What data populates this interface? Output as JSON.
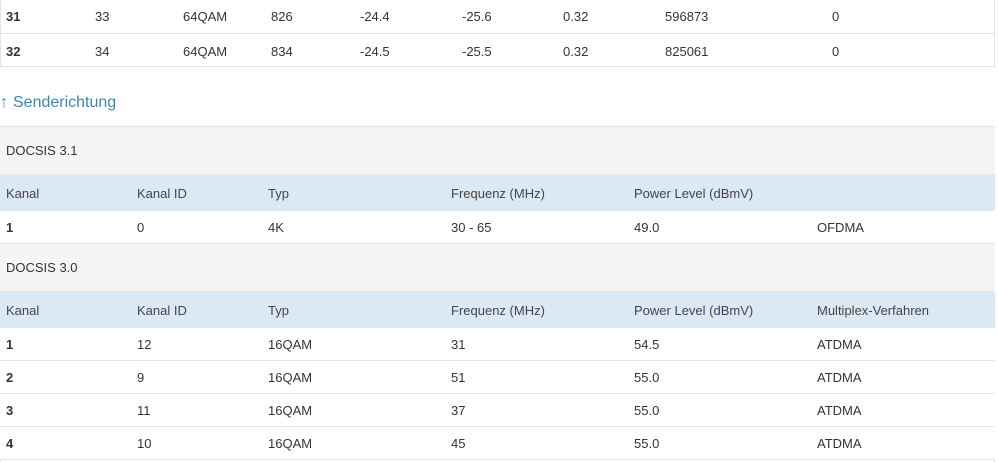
{
  "downstream_partial": {
    "rows": [
      [
        "31",
        "33",
        "64QAM",
        "826",
        "-24.4",
        "-25.6",
        "0.32",
        "596873",
        "0"
      ],
      [
        "32",
        "34",
        "64QAM",
        "834",
        "-24.5",
        "-25.5",
        "0.32",
        "825061",
        "0"
      ]
    ]
  },
  "upstream": {
    "heading": "Senderichtung",
    "arrow_icon": "↑",
    "docsis31": {
      "title": "DOCSIS 3.1",
      "headers": [
        "Kanal",
        "Kanal ID",
        "Typ",
        "Frequenz (MHz)",
        "Power Level (dBmV)",
        ""
      ],
      "rows": [
        [
          "1",
          "0",
          "4K",
          "30 - 65",
          "49.0",
          "OFDMA"
        ]
      ]
    },
    "docsis30": {
      "title": "DOCSIS 3.0",
      "headers": [
        "Kanal",
        "Kanal ID",
        "Typ",
        "Frequenz (MHz)",
        "Power Level (dBmV)",
        "Multiplex-Verfahren"
      ],
      "rows": [
        [
          "1",
          "12",
          "16QAM",
          "31",
          "54.5",
          "ATDMA"
        ],
        [
          "2",
          "9",
          "16QAM",
          "51",
          "55.0",
          "ATDMA"
        ],
        [
          "3",
          "11",
          "16QAM",
          "37",
          "55.0",
          "ATDMA"
        ],
        [
          "4",
          "10",
          "16QAM",
          "45",
          "55.0",
          "ATDMA"
        ]
      ]
    }
  },
  "colors": {
    "heading": "#3d86b4",
    "section_bg": "#f5f5f3",
    "header_bg": "#dbe9f5"
  }
}
